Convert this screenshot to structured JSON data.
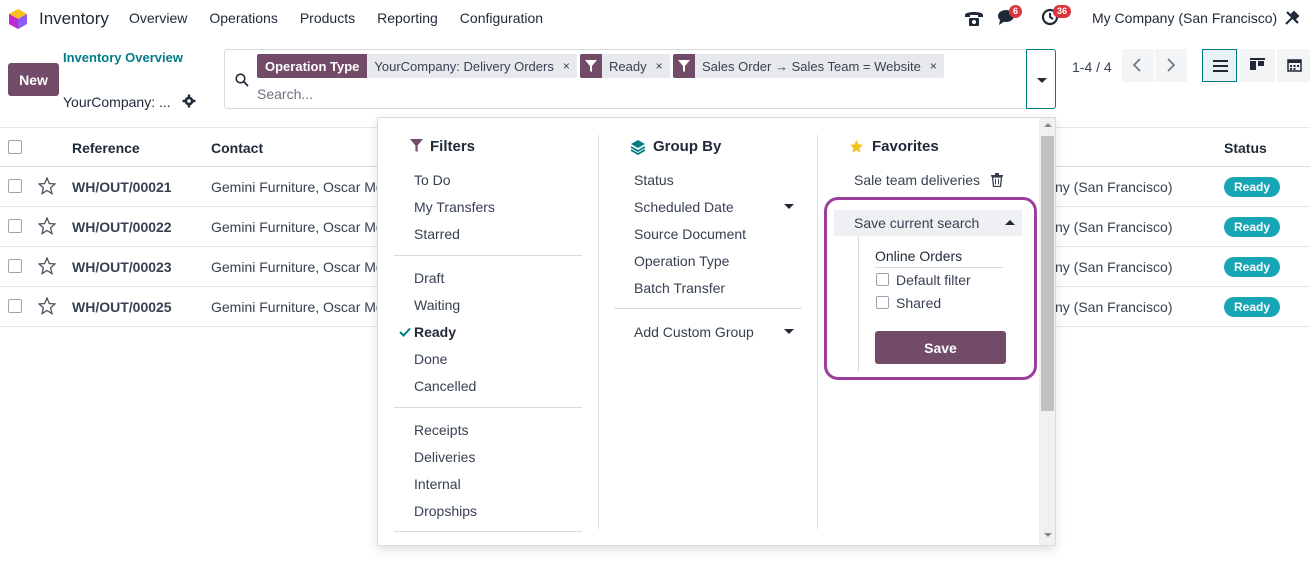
{
  "app": {
    "name": "Inventory",
    "accent": "#714b67",
    "link_color": "#017e84"
  },
  "nav": {
    "items": [
      "Overview",
      "Operations",
      "Products",
      "Reporting",
      "Configuration"
    ]
  },
  "systray": {
    "messages_badge": "6",
    "activities_badge": "36",
    "company": "My Company (San Francisco)"
  },
  "control": {
    "new_label": "New",
    "breadcrumb_parent": "Inventory Overview",
    "breadcrumb_current": "YourCompany: ..."
  },
  "search": {
    "facets": [
      {
        "tag": "Operation Type",
        "value": "YourCompany: Delivery Orders"
      },
      {
        "tag": "filter-icon",
        "value": "Ready"
      },
      {
        "tag": "filter-icon",
        "value": "Sales Order → Sales Team = Website"
      }
    ],
    "remove_glyph": "×",
    "placeholder": "Search..."
  },
  "pager": {
    "value": "1-4 / 4"
  },
  "list": {
    "headers": {
      "reference": "Reference",
      "contact": "Contact",
      "status": "Status"
    },
    "rows": [
      {
        "reference": "WH/OUT/00021",
        "contact": "Gemini Furniture, Oscar Mo",
        "company": "ny (San Francisco)",
        "status": "Ready"
      },
      {
        "reference": "WH/OUT/00022",
        "contact": "Gemini Furniture, Oscar Mo",
        "company": "ny (San Francisco)",
        "status": "Ready"
      },
      {
        "reference": "WH/OUT/00023",
        "contact": "Gemini Furniture, Oscar Mo",
        "company": "ny (San Francisco)",
        "status": "Ready"
      },
      {
        "reference": "WH/OUT/00025",
        "contact": "Gemini Furniture, Oscar Mo",
        "company": "ny (San Francisco)",
        "status": "Ready"
      }
    ],
    "status_color": "#16a6b6"
  },
  "dropdown": {
    "filters": {
      "title": "Filters",
      "groups": [
        [
          "To Do",
          "My Transfers",
          "Starred"
        ],
        [
          "Draft",
          "Waiting",
          "Ready",
          "Done",
          "Cancelled"
        ],
        [
          "Receipts",
          "Deliveries",
          "Internal",
          "Dropships"
        ]
      ],
      "selected": "Ready"
    },
    "group_by": {
      "title": "Group By",
      "items": [
        "Status",
        "Scheduled Date",
        "Source Document",
        "Operation Type",
        "Batch Transfer"
      ],
      "custom": "Add Custom Group"
    },
    "favorites": {
      "title": "Favorites",
      "saved": "Sale team deliveries",
      "save_current": "Save current search",
      "name_value": "Online Orders",
      "default_filter": "Default filter",
      "shared": "Shared",
      "save_label": "Save",
      "highlight_color": "#9b3f9b"
    }
  }
}
